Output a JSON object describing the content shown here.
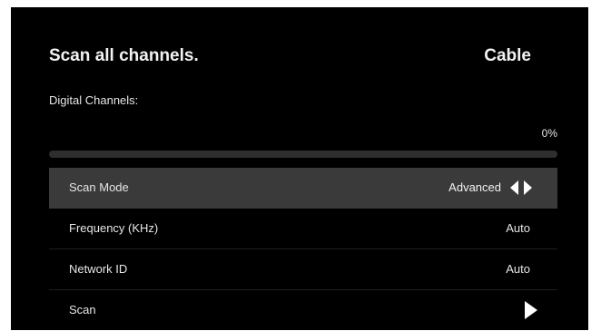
{
  "header": {
    "title": "Scan all channels.",
    "source": "Cable"
  },
  "progress": {
    "label": "Digital Channels:",
    "percent_text": "0%",
    "value": 0
  },
  "menu": {
    "items": [
      {
        "label": "Scan Mode",
        "value": "Advanced",
        "selected": true,
        "icon": "left-right-arrows-icon"
      },
      {
        "label": "Frequency (KHz)",
        "value": "Auto"
      },
      {
        "label": "Network ID",
        "value": "Auto"
      },
      {
        "label": "Scan",
        "icon": "play-icon"
      }
    ]
  },
  "colors": {
    "background": "#000000",
    "selected_row": "#3a3a3a",
    "text": "#e6e6e6"
  }
}
